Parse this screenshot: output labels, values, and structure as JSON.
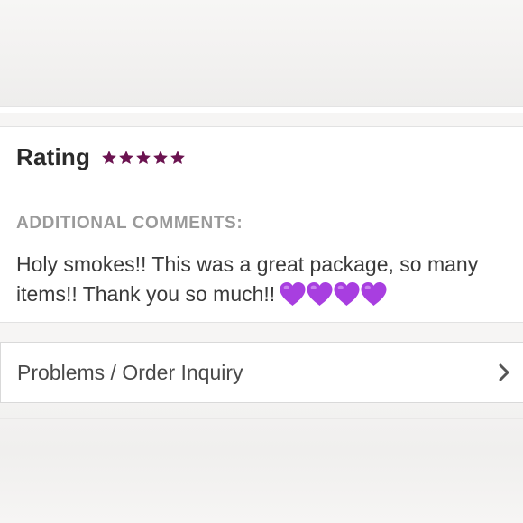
{
  "rating": {
    "label": "Rating",
    "stars": 5,
    "max_stars": 5,
    "star_color": "#6b1350",
    "star_icon": "star-icon"
  },
  "comments": {
    "heading": "ADDITIONAL COMMENTS:",
    "text": "Holy smokes!! This was a great package, so many items!! Thank you so much!!",
    "hearts": 4,
    "heart_icon": "purple-heart-icon",
    "heart_color": "#a83ee0"
  },
  "problems": {
    "label": "Problems / Order Inquiry",
    "icon": "chevron-right-icon"
  }
}
